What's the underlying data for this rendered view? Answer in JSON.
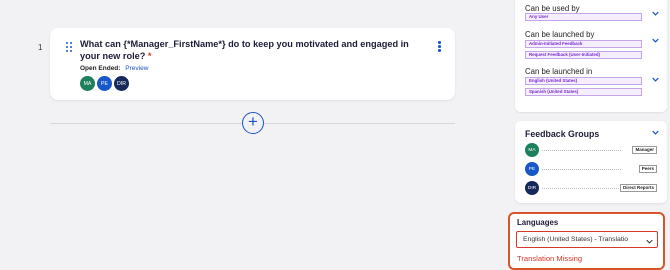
{
  "question": {
    "number": "1",
    "text": "What can {*Manager_FirstName*} do to keep you motivated and engaged in your new role?",
    "required_mark": "*",
    "type_label": "Open Ended:",
    "preview_link": "Preview",
    "audience": [
      "MA",
      "PE",
      "DIR"
    ]
  },
  "add_button": "+",
  "settings": {
    "used_by": {
      "title": "Can be used by",
      "tags": [
        "Any User"
      ]
    },
    "launched_by": {
      "title": "Can be launched by",
      "tags": [
        "Admin-Initiated Feedback",
        "Request Feedback (User-Initiated)"
      ]
    },
    "launched_in": {
      "title": "Can be launched in",
      "tags": [
        "English (United States)",
        "Spanish (United States)"
      ]
    }
  },
  "feedback_groups": {
    "title": "Feedback Groups",
    "rows": [
      {
        "initials": "MA",
        "role": "Manager"
      },
      {
        "initials": "PE",
        "role": "Peers"
      },
      {
        "initials": "DIR",
        "role": "Direct Reports"
      }
    ]
  },
  "languages": {
    "title": "Languages",
    "selected": "English (United States) - Translatio",
    "error": "Translation Missing"
  },
  "colors": {
    "accent": "#1a56c9",
    "error": "#d6392c",
    "tag_text": "#7a2bd0",
    "avatar_green": "#1e7f5c",
    "avatar_blue": "#1857c7",
    "avatar_navy": "#15295a"
  }
}
